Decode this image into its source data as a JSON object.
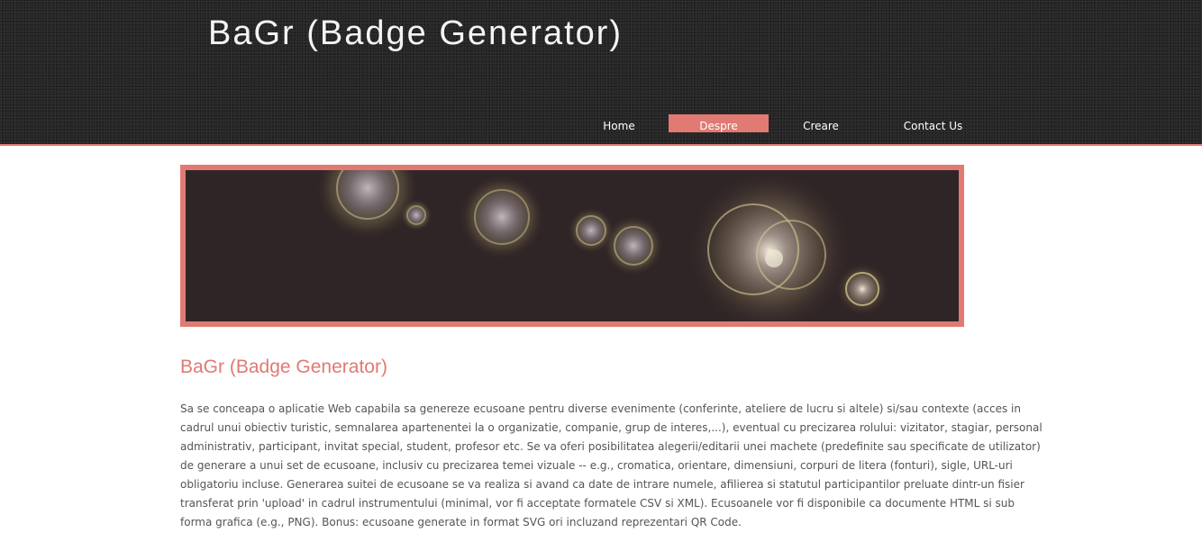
{
  "header": {
    "title": "BaGr (Badge Generator)",
    "background_color": "#262626",
    "accent_color": "#e07a73"
  },
  "nav": {
    "items": [
      {
        "label": "Home",
        "active": false
      },
      {
        "label": "Despre",
        "active": true
      },
      {
        "label": "Creare",
        "active": false
      },
      {
        "label": "Contact Us",
        "active": false
      }
    ]
  },
  "banner": {
    "image": "bokeh-lights-banner",
    "frame_color": "#e07a73"
  },
  "content": {
    "heading": "BaGr (Badge Generator)",
    "body": "Sa se conceapa o aplicatie Web capabila sa genereze ecusoane pentru diverse evenimente (conferinte, ateliere de lucru si altele) si/sau contexte (acces in cadrul unui obiectiv turistic, semnalarea apartenentei la o organizatie, companie, grup de interes,...), eventual cu precizarea rolului: vizitator, stagiar, personal administrativ, participant, invitat special, student, profesor etc. Se va oferi posibilitatea alegerii/editarii unei machete (predefinite sau specificate de utilizator) de generare a unui set de ecusoane, inclusiv cu precizarea temei vizuale -- e.g., cromatica, orientare, dimensiuni, corpuri de litera (fonturi), sigle, URL-uri obligatoriu incluse. Generarea suitei de ecusoane se va realiza si avand ca date de intrare numele, afilierea si statutul participantilor preluate dintr-un fisier transferat prin 'upload' in cadrul instrumentului (minimal, vor fi acceptate formatele CSV si XML). Ecusoanele vor fi disponibile ca documente HTML si sub forma grafica (e.g., PNG). Bonus: ecusoane generate in format SVG ori incluzand reprezentari QR Code."
  }
}
